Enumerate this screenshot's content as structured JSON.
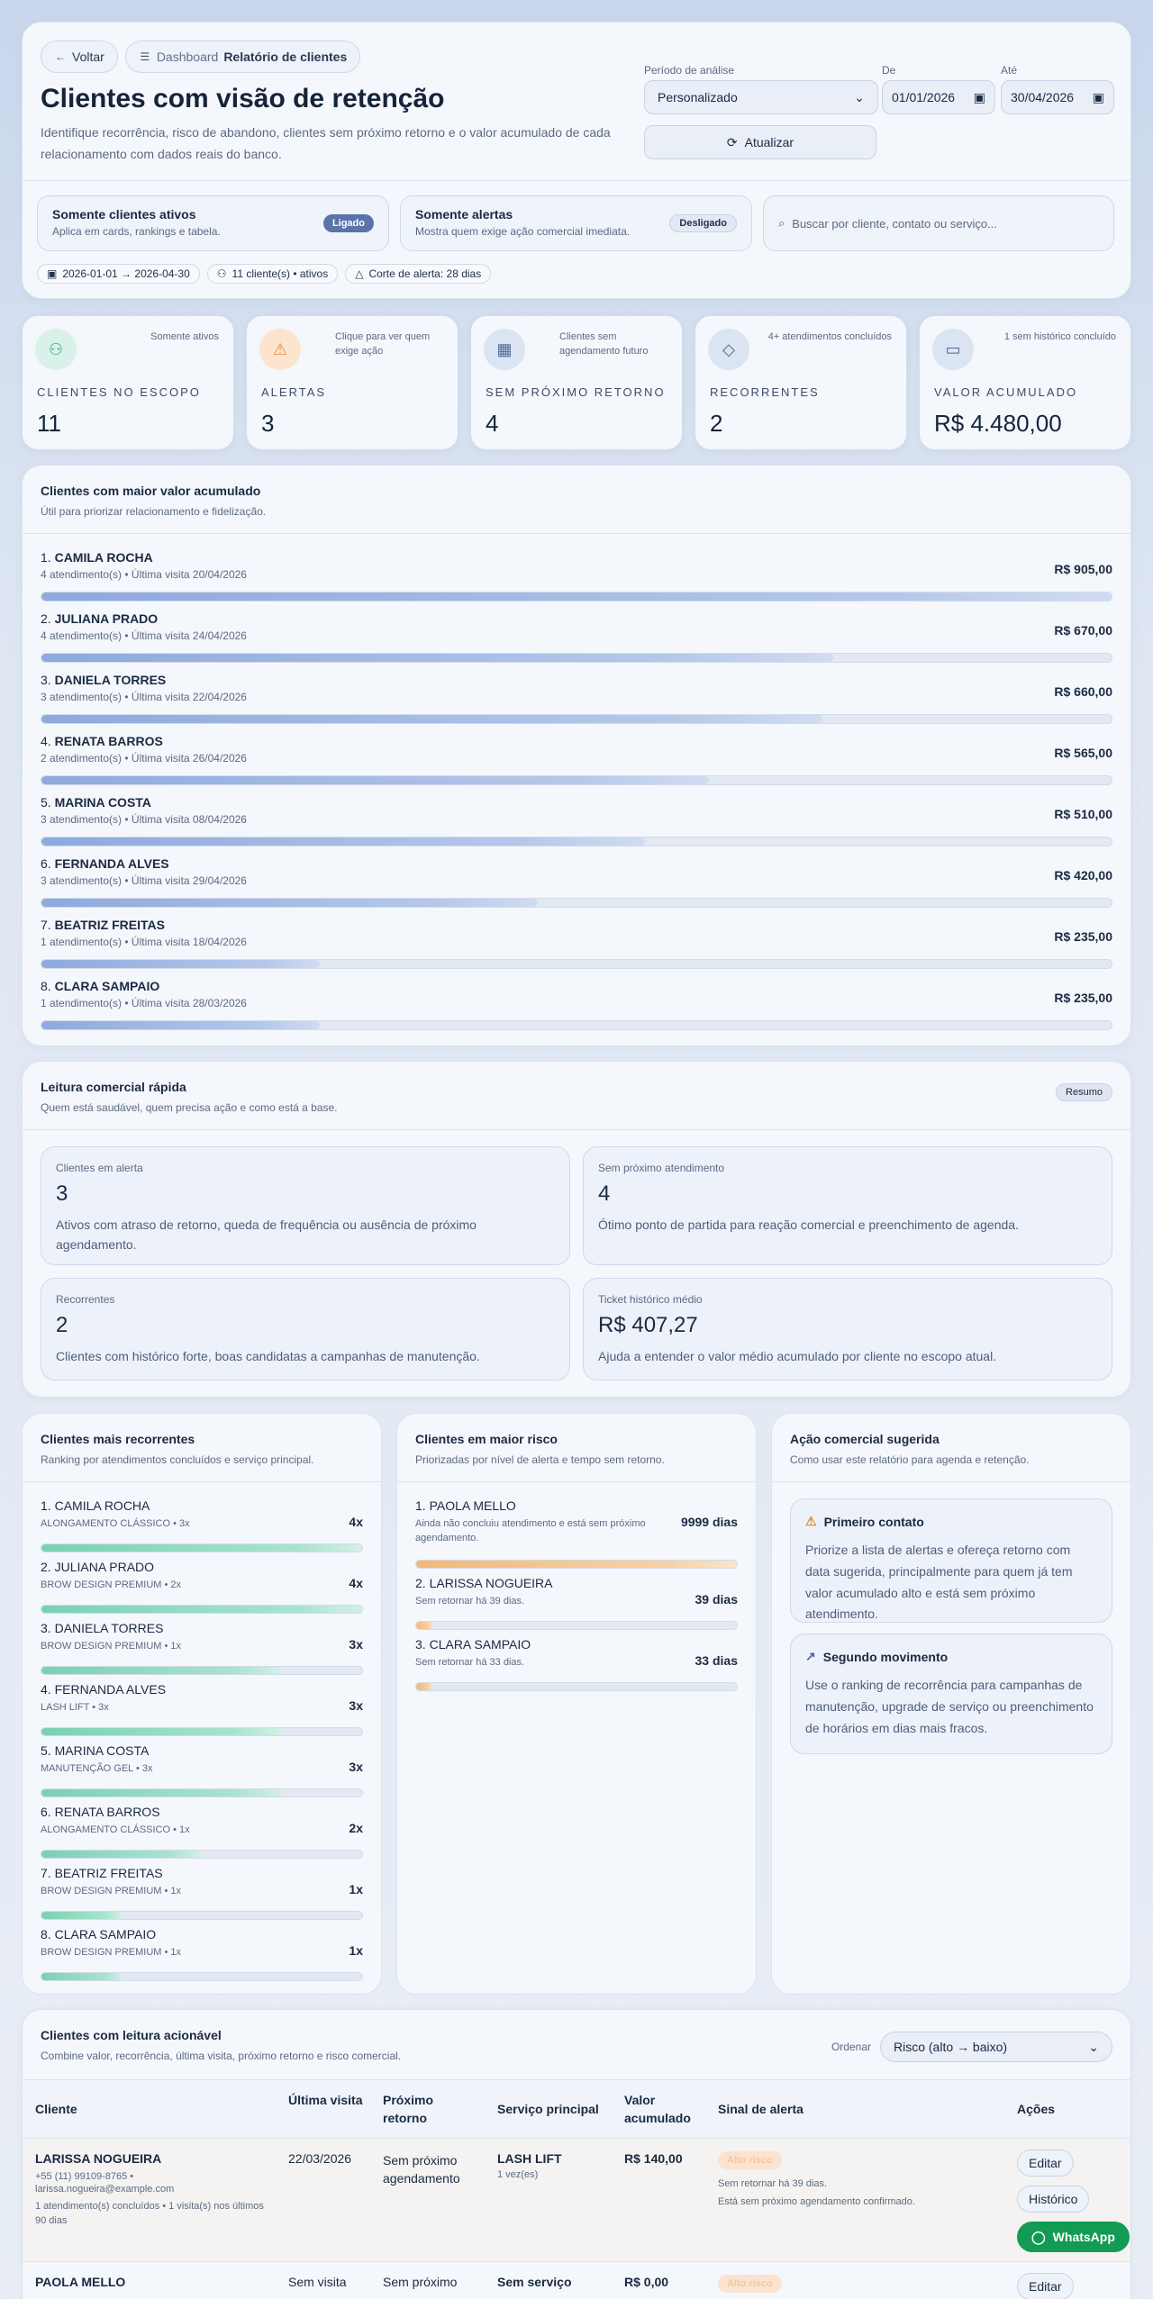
{
  "header": {
    "back_label": "Voltar",
    "breadcrumb_parent": "Dashboard",
    "breadcrumb_current": "Relatório de clientes",
    "title": "Clientes com visão de retenção",
    "subtitle_line1": "Identifique recorrência, risco de abandono, clientes sem próximo retorno e o valor acumulado de cada",
    "subtitle_line2": "relacionamento com dados reais do banco.",
    "period_label": "Período de análise",
    "period_value": "Personalizado",
    "from_label": "De",
    "from_value": "01/01/2026",
    "to_label": "Até",
    "to_value": "30/04/2026",
    "refresh_label": "Atualizar"
  },
  "filters": {
    "active_title": "Somente clientes ativos",
    "active_desc": "Aplica em cards, rankings e tabela.",
    "active_state": "Ligado",
    "alerts_title": "Somente alertas",
    "alerts_desc": "Mostra quem exige ação comercial imediata.",
    "alerts_state": "Desligado",
    "search_placeholder": "Buscar por cliente, contato ou serviço...",
    "chip_range": "2026-01-01 → 2026-04-30",
    "chip_clients": "11 cliente(s) • ativos",
    "chip_cutoff": "Corte de alerta: 28 dias"
  },
  "stats": [
    {
      "hint": "Somente ativos",
      "label": "CLIENTES NO ESCOPO",
      "value": "11",
      "icon": "users-icon"
    },
    {
      "hint": "Clique para ver quem exige ação",
      "label": "ALERTAS",
      "value": "3",
      "icon": "warning-icon"
    },
    {
      "hint": "Clientes sem agendamento futuro",
      "label": "SEM PRÓXIMO RETORNO",
      "value": "4",
      "icon": "calendar-clock-icon"
    },
    {
      "hint": "4+ atendimentos concluídos",
      "label": "RECORRENTES",
      "value": "2",
      "icon": "diamond-icon"
    },
    {
      "hint": "1 sem histórico concluído",
      "label": "VALOR ACUMULADO",
      "value": "R$ 4.480,00",
      "icon": "wallet-icon"
    }
  ],
  "top_value": {
    "title": "Clientes com maior valor acumulado",
    "subtitle": "Útil para priorizar relacionamento e fidelização.",
    "rows": [
      {
        "rank": "1.",
        "name": "CAMILA ROCHA",
        "meta": "4 atendimento(s) • Última visita 20/04/2026",
        "amount": "R$ 905,00",
        "pct": 1.0
      },
      {
        "rank": "2.",
        "name": "JULIANA PRADO",
        "meta": "4 atendimento(s) • Última visita 24/04/2026",
        "amount": "R$ 670,00",
        "pct": 0.74
      },
      {
        "rank": "3.",
        "name": "DANIELA TORRES",
        "meta": "3 atendimento(s) • Última visita 22/04/2026",
        "amount": "R$ 660,00",
        "pct": 0.73
      },
      {
        "rank": "4.",
        "name": "RENATA BARROS",
        "meta": "2 atendimento(s) • Última visita 26/04/2026",
        "amount": "R$ 565,00",
        "pct": 0.624
      },
      {
        "rank": "5.",
        "name": "MARINA COSTA",
        "meta": "3 atendimento(s) • Última visita 08/04/2026",
        "amount": "R$ 510,00",
        "pct": 0.564
      },
      {
        "rank": "6.",
        "name": "FERNANDA ALVES",
        "meta": "3 atendimento(s) • Última visita 29/04/2026",
        "amount": "R$ 420,00",
        "pct": 0.464
      },
      {
        "rank": "7.",
        "name": "BEATRIZ FREITAS",
        "meta": "1 atendimento(s) • Última visita 18/04/2026",
        "amount": "R$ 235,00",
        "pct": 0.26
      },
      {
        "rank": "8.",
        "name": "CLARA SAMPAIO",
        "meta": "1 atendimento(s) • Última visita 28/03/2026",
        "amount": "R$ 235,00",
        "pct": 0.26
      }
    ]
  },
  "quick": {
    "title": "Leitura comercial rápida",
    "subtitle": "Quem está saudável, quem precisa ação e como está a base.",
    "badge": "Resumo",
    "boxes": [
      {
        "label": "Clientes em alerta",
        "value": "3",
        "desc": "Ativos com atraso de retorno, queda de frequência ou ausência de próximo agendamento."
      },
      {
        "label": "Sem próximo atendimento",
        "value": "4",
        "desc": "Ótimo ponto de partida para reação comercial e preenchimento de agenda."
      },
      {
        "label": "Recorrentes",
        "value": "2",
        "desc": "Clientes com histórico forte, boas candidatas a campanhas de manutenção."
      },
      {
        "label": "Ticket histórico médio",
        "value": "R$ 407,27",
        "desc": "Ajuda a entender o valor médio acumulado por cliente no escopo atual."
      }
    ]
  },
  "recurrent": {
    "title": "Clientes mais recorrentes",
    "subtitle": "Ranking por atendimentos concluídos e serviço principal.",
    "rows": [
      {
        "rank": "1.",
        "name": "CAMILA ROCHA",
        "meta": "ALONGAMENTO CLÁSSICO • 3x",
        "count": "4x",
        "pct": 1.0
      },
      {
        "rank": "2.",
        "name": "JULIANA PRADO",
        "meta": "BROW DESIGN PREMIUM • 2x",
        "count": "4x",
        "pct": 1.0
      },
      {
        "rank": "3.",
        "name": "DANIELA TORRES",
        "meta": "BROW DESIGN PREMIUM • 1x",
        "count": "3x",
        "pct": 0.75
      },
      {
        "rank": "4.",
        "name": "FERNANDA ALVES",
        "meta": "LASH LIFT • 3x",
        "count": "3x",
        "pct": 0.75
      },
      {
        "rank": "5.",
        "name": "MARINA COSTA",
        "meta": "MANUTENÇÃO GEL • 3x",
        "count": "3x",
        "pct": 0.75
      },
      {
        "rank": "6.",
        "name": "RENATA BARROS",
        "meta": "ALONGAMENTO CLÁSSICO • 1x",
        "count": "2x",
        "pct": 0.5
      },
      {
        "rank": "7.",
        "name": "BEATRIZ FREITAS",
        "meta": "BROW DESIGN PREMIUM • 1x",
        "count": "1x",
        "pct": 0.25
      },
      {
        "rank": "8.",
        "name": "CLARA SAMPAIO",
        "meta": "BROW DESIGN PREMIUM • 1x",
        "count": "1x",
        "pct": 0.25
      }
    ]
  },
  "risk": {
    "title": "Clientes em maior risco",
    "subtitle": "Priorizadas por nível de alerta e tempo sem retorno.",
    "rows": [
      {
        "rank": "1.",
        "name": "PAOLA MELLO",
        "meta": "Ainda não concluiu atendimento e está sem próximo agendamento.",
        "days": "9999 dias",
        "pct": 1.0
      },
      {
        "rank": "2.",
        "name": "LARISSA NOGUEIRA",
        "meta": "Sem retornar há 39 dias.",
        "days": "39 dias",
        "pct": 0.05
      },
      {
        "rank": "3.",
        "name": "CLARA SAMPAIO",
        "meta": "Sem retornar há 33 dias.",
        "days": "33 dias",
        "pct": 0.05
      }
    ]
  },
  "action": {
    "title": "Ação comercial sugerida",
    "subtitle": "Como usar este relatório para agenda e retenção.",
    "boxes": [
      {
        "title": "Primeiro contato",
        "desc": "Priorize a lista de alertas e ofereça retorno com data sugerida, principalmente para quem já tem valor acumulado alto e está sem próximo atendimento."
      },
      {
        "title": "Segundo movimento",
        "desc": "Use o ranking de recorrência para campanhas de manutenção, upgrade de serviço ou preenchimento de horários em dias mais fracos."
      }
    ]
  },
  "table": {
    "title": "Clientes com leitura acionável",
    "subtitle": "Combine valor, recorrência, última visita, próximo retorno e risco comercial.",
    "order_label": "Ordenar",
    "order_value": "Risco (alto → baixo)",
    "headers": {
      "client": "Cliente",
      "last": "Última visita",
      "next": "Próximo retorno",
      "service": "Serviço principal",
      "value": "Valor acumulado",
      "signal": "Sinal de alerta",
      "actions": "Ações"
    },
    "rows": [
      {
        "name": "LARISSA NOGUEIRA",
        "phone": "+55 (11) 99109-8765 •",
        "email": "larissa.nogueira@example.com",
        "summary": "1 atendimento(s) concluídos • 1 visita(s) nos últimos 90 dias",
        "last": "22/03/2026",
        "next": "Sem próximo agendamento",
        "service": "LASH LIFT",
        "service_count": "1 vez(es)",
        "value": "R$ 140,00",
        "risk_badge": "Alto risco",
        "signal1": "Sem retornar há 39 dias.",
        "signal2": "Está sem próximo agendamento confirmado."
      },
      {
        "name": "PAOLA MELLO",
        "last": "Sem visita",
        "next": "Sem próximo",
        "service": "Sem serviço",
        "value": "R$ 0,00",
        "risk_badge": "Alto risco"
      }
    ],
    "btn_edit": "Editar",
    "btn_history": "Histórico",
    "btn_whatsapp": "WhatsApp"
  }
}
